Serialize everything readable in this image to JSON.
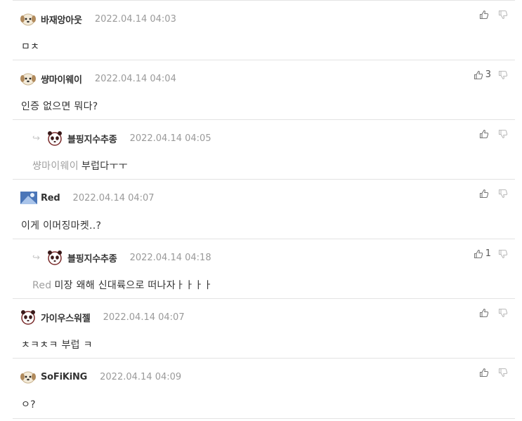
{
  "comments": [
    {
      "nick": "바재앙아웃",
      "date": "2022.04.14 04:03",
      "mention": "",
      "text": "ㅁㅊ",
      "likes": "",
      "avatar": "puppy"
    },
    {
      "nick": "썅마이웨이",
      "date": "2022.04.14 04:04",
      "mention": "",
      "text": "인증 없으면 뭐다?",
      "likes": "3",
      "avatar": "puppy"
    },
    {
      "nick": "블핑지수추종",
      "date": "2022.04.14 04:05",
      "mention": "썅마이웨이",
      "text": "부럽다ㅜㅜ",
      "likes": "",
      "avatar": "panda"
    },
    {
      "nick": "Red",
      "date": "2022.04.14 04:07",
      "mention": "",
      "text": "이게 이머징마켓..?",
      "likes": "",
      "avatar": "blue"
    },
    {
      "nick": "블핑지수추종",
      "date": "2022.04.14 04:18",
      "mention": "Red",
      "text": "미장 왜해 신대륙으로 떠나자ㅏㅏㅏㅏ",
      "likes": "1",
      "avatar": "panda"
    },
    {
      "nick": "가이우스워젤",
      "date": "2022.04.14 04:07",
      "mention": "",
      "text": "ㅊㅋㅊㅋ 부럽 ㅋ",
      "likes": "",
      "avatar": "panda"
    },
    {
      "nick": "SoFiKiNG",
      "date": "2022.04.14 04:09",
      "mention": "",
      "text": "ㅇ?",
      "likes": "",
      "avatar": "puppy"
    }
  ],
  "icons": {
    "like": "thumbs-up-icon",
    "dislike": "thumbs-down-icon",
    "reply": "reply-arrow-icon"
  }
}
